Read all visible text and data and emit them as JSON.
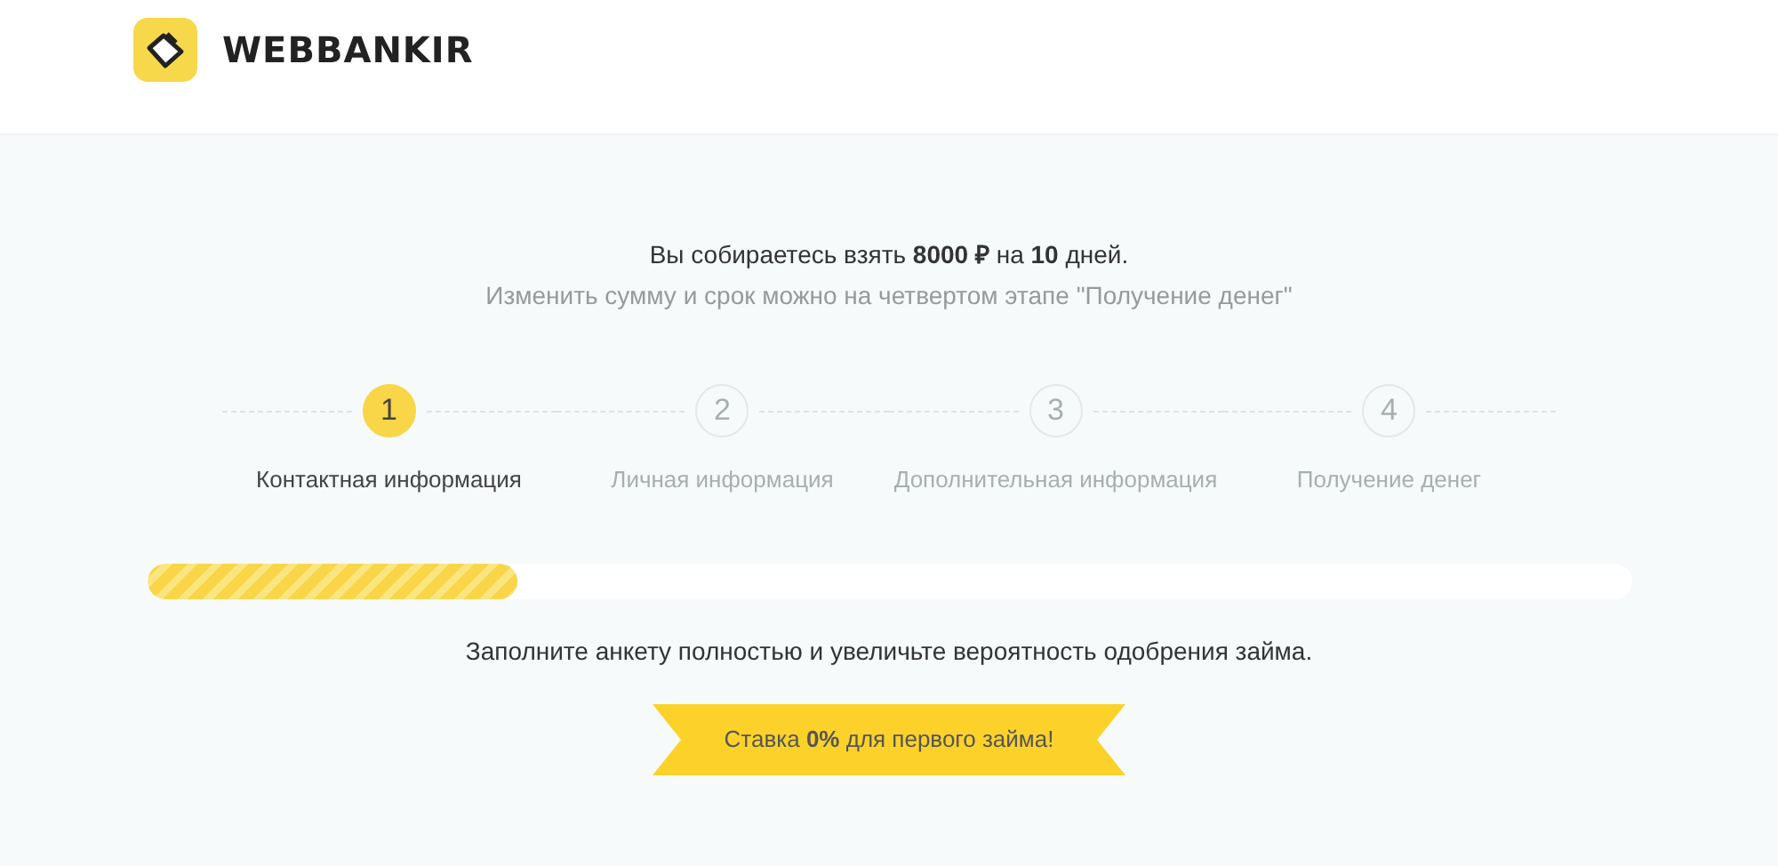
{
  "header": {
    "logo_text": "WEBBANKIR"
  },
  "summary": {
    "line": "Вы собираетесь взять **8000 ₽** на **10** дней.",
    "hint": "Изменить сумму и срок можно на четвертом этапе \"Получение денег\""
  },
  "steps": [
    {
      "number": "1",
      "label": "Контактная информация",
      "selected": true
    },
    {
      "number": "2",
      "label": "Личная информация",
      "selected": false
    },
    {
      "number": "3",
      "label": "Дополнительная информация",
      "selected": false
    },
    {
      "number": "4",
      "label": "Получение денег",
      "selected": false
    }
  ],
  "progress": {
    "level": 0.25
  },
  "note": "Заполните анкету полностью и увеличьте вероятность одобрения займа.",
  "ribbon": "Ставка **0%** для первого займа!"
}
